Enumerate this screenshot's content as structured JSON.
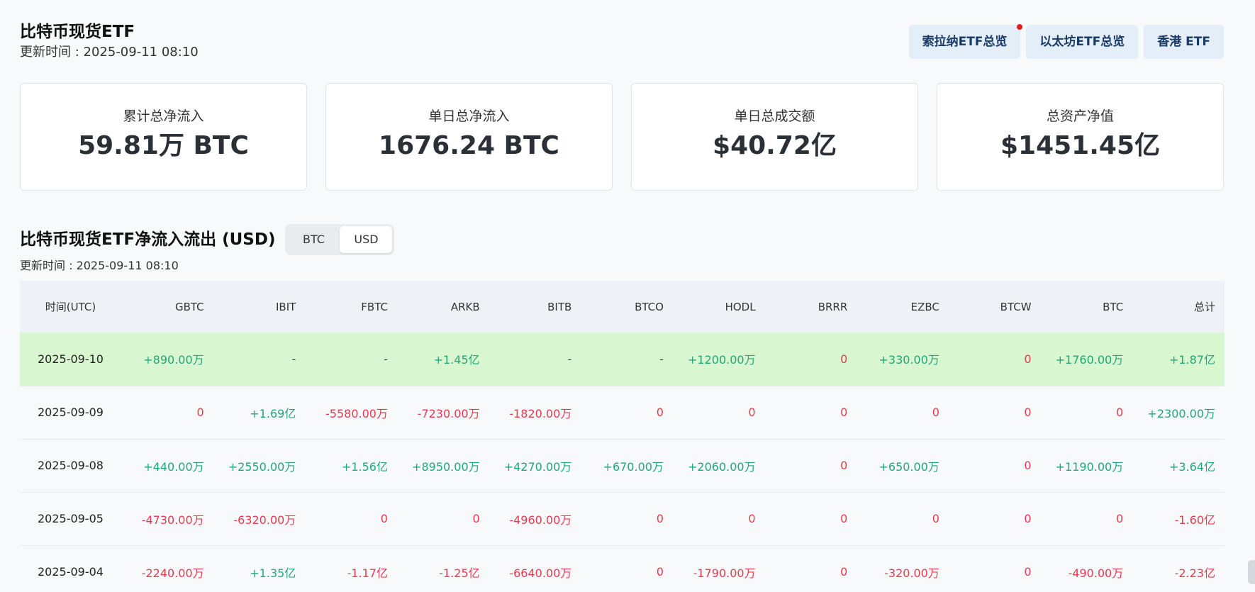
{
  "header": {
    "title": "比特币现货ETF",
    "update_time": "更新时间 : 2025-09-11 08:10"
  },
  "top_buttons": [
    {
      "label": "索拉纳ETF总览",
      "has_dot": true
    },
    {
      "label": "以太坊ETF总览",
      "has_dot": false
    },
    {
      "label": "香港 ETF",
      "has_dot": false
    }
  ],
  "stats": [
    {
      "label": "累计总净流入",
      "value": "59.81万 BTC"
    },
    {
      "label": "单日总净流入",
      "value": "1676.24 BTC"
    },
    {
      "label": "单日总成交额",
      "value": "$40.72亿"
    },
    {
      "label": "总资产净值",
      "value": "$1451.45亿"
    }
  ],
  "section": {
    "title": "比特币现货ETF净流入流出 (USD)",
    "update_time": "更新时间 : 2025-09-11 08:10",
    "toggle": {
      "options": [
        "BTC",
        "USD"
      ],
      "selected": "USD"
    }
  },
  "colors": {
    "positive": "#22a77a",
    "negative": "#e63a4f",
    "highlight": "#d8f7d0",
    "button_bg": "#e4eef9"
  },
  "table": {
    "columns": [
      "时间(UTC)",
      "GBTC",
      "IBIT",
      "FBTC",
      "ARKB",
      "BITB",
      "BTCO",
      "HODL",
      "BRRR",
      "EZBC",
      "BTCW",
      "BTC",
      "总计"
    ],
    "rows": [
      {
        "highlight": true,
        "cells": [
          "2025-09-10",
          "+890.00万",
          "-",
          "-",
          "+1.45亿",
          "-",
          "-",
          "+1200.00万",
          "0",
          "+330.00万",
          "0",
          "+1760.00万",
          "+1.87亿"
        ]
      },
      {
        "highlight": false,
        "cells": [
          "2025-09-09",
          "0",
          "+1.69亿",
          "-5580.00万",
          "-7230.00万",
          "-1820.00万",
          "0",
          "0",
          "0",
          "0",
          "0",
          "0",
          "+2300.00万"
        ]
      },
      {
        "highlight": false,
        "cells": [
          "2025-09-08",
          "+440.00万",
          "+2550.00万",
          "+1.56亿",
          "+8950.00万",
          "+4270.00万",
          "+670.00万",
          "+2060.00万",
          "0",
          "+650.00万",
          "0",
          "+1190.00万",
          "+3.64亿"
        ]
      },
      {
        "highlight": false,
        "cells": [
          "2025-09-05",
          "-4730.00万",
          "-6320.00万",
          "0",
          "0",
          "-4960.00万",
          "0",
          "0",
          "0",
          "0",
          "0",
          "0",
          "-1.60亿"
        ]
      },
      {
        "highlight": false,
        "cells": [
          "2025-09-04",
          "-2240.00万",
          "+1.35亿",
          "-1.17亿",
          "-1.25亿",
          "-6640.00万",
          "0",
          "-1790.00万",
          "0",
          "-320.00万",
          "0",
          "-490.00万",
          "-2.23亿"
        ]
      }
    ]
  }
}
